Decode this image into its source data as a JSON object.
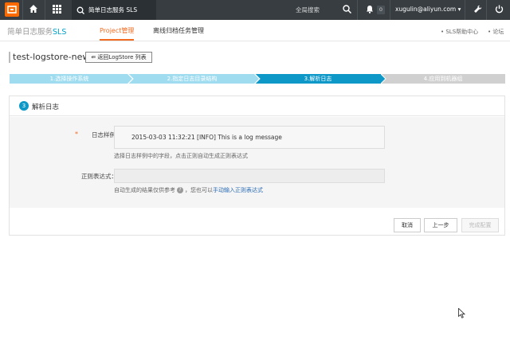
{
  "topbar": {
    "product_tab": "简单日志服务 SLS",
    "search_placeholder": "全局搜索",
    "message_count": "0",
    "user": "xugulin@aliyun.com"
  },
  "subnav": {
    "brand_prefix": "简单日志服务",
    "brand_suffix": "SLS",
    "project_tab": "Project管理",
    "offline_tab": "离线归档任务管理",
    "help": "SLS帮助中心",
    "forum": "论坛"
  },
  "header": {
    "title": "test-logstore-new",
    "back_button": "返回LogStore 列表"
  },
  "steps": [
    {
      "label": "1.选择操作系统",
      "state": "done"
    },
    {
      "label": "2.指定日志目录结构",
      "state": "done"
    },
    {
      "label": "3.解析日志",
      "state": "active"
    },
    {
      "label": "4.应用到机器组",
      "state": "pending"
    }
  ],
  "panel": {
    "step_number": "3",
    "title": "解析日志",
    "required_mark": "*",
    "sample_label": "日志样例",
    "sample_value": "2015-03-03 11:32:21 [INFO] This is a log message",
    "sample_hint": "选择日志样例中的字段，点击正则自动生成正则表达式",
    "regex_label": "正则表达式：",
    "regex_value": "",
    "regex_hint_prefix": "自动生成的结果仅供参考",
    "regex_hint_middle": "，您也可以",
    "regex_hint_link": "手动输入正则表达式"
  },
  "buttons": {
    "cancel": "取消",
    "prev": "上一步",
    "finish": "完成配置"
  },
  "colors": {
    "topbar": "#373d41",
    "accent": "#f26b21",
    "step_done": "#9fdcef",
    "step_active": "#0e98c8",
    "step_pending": "#d0d0d0"
  }
}
